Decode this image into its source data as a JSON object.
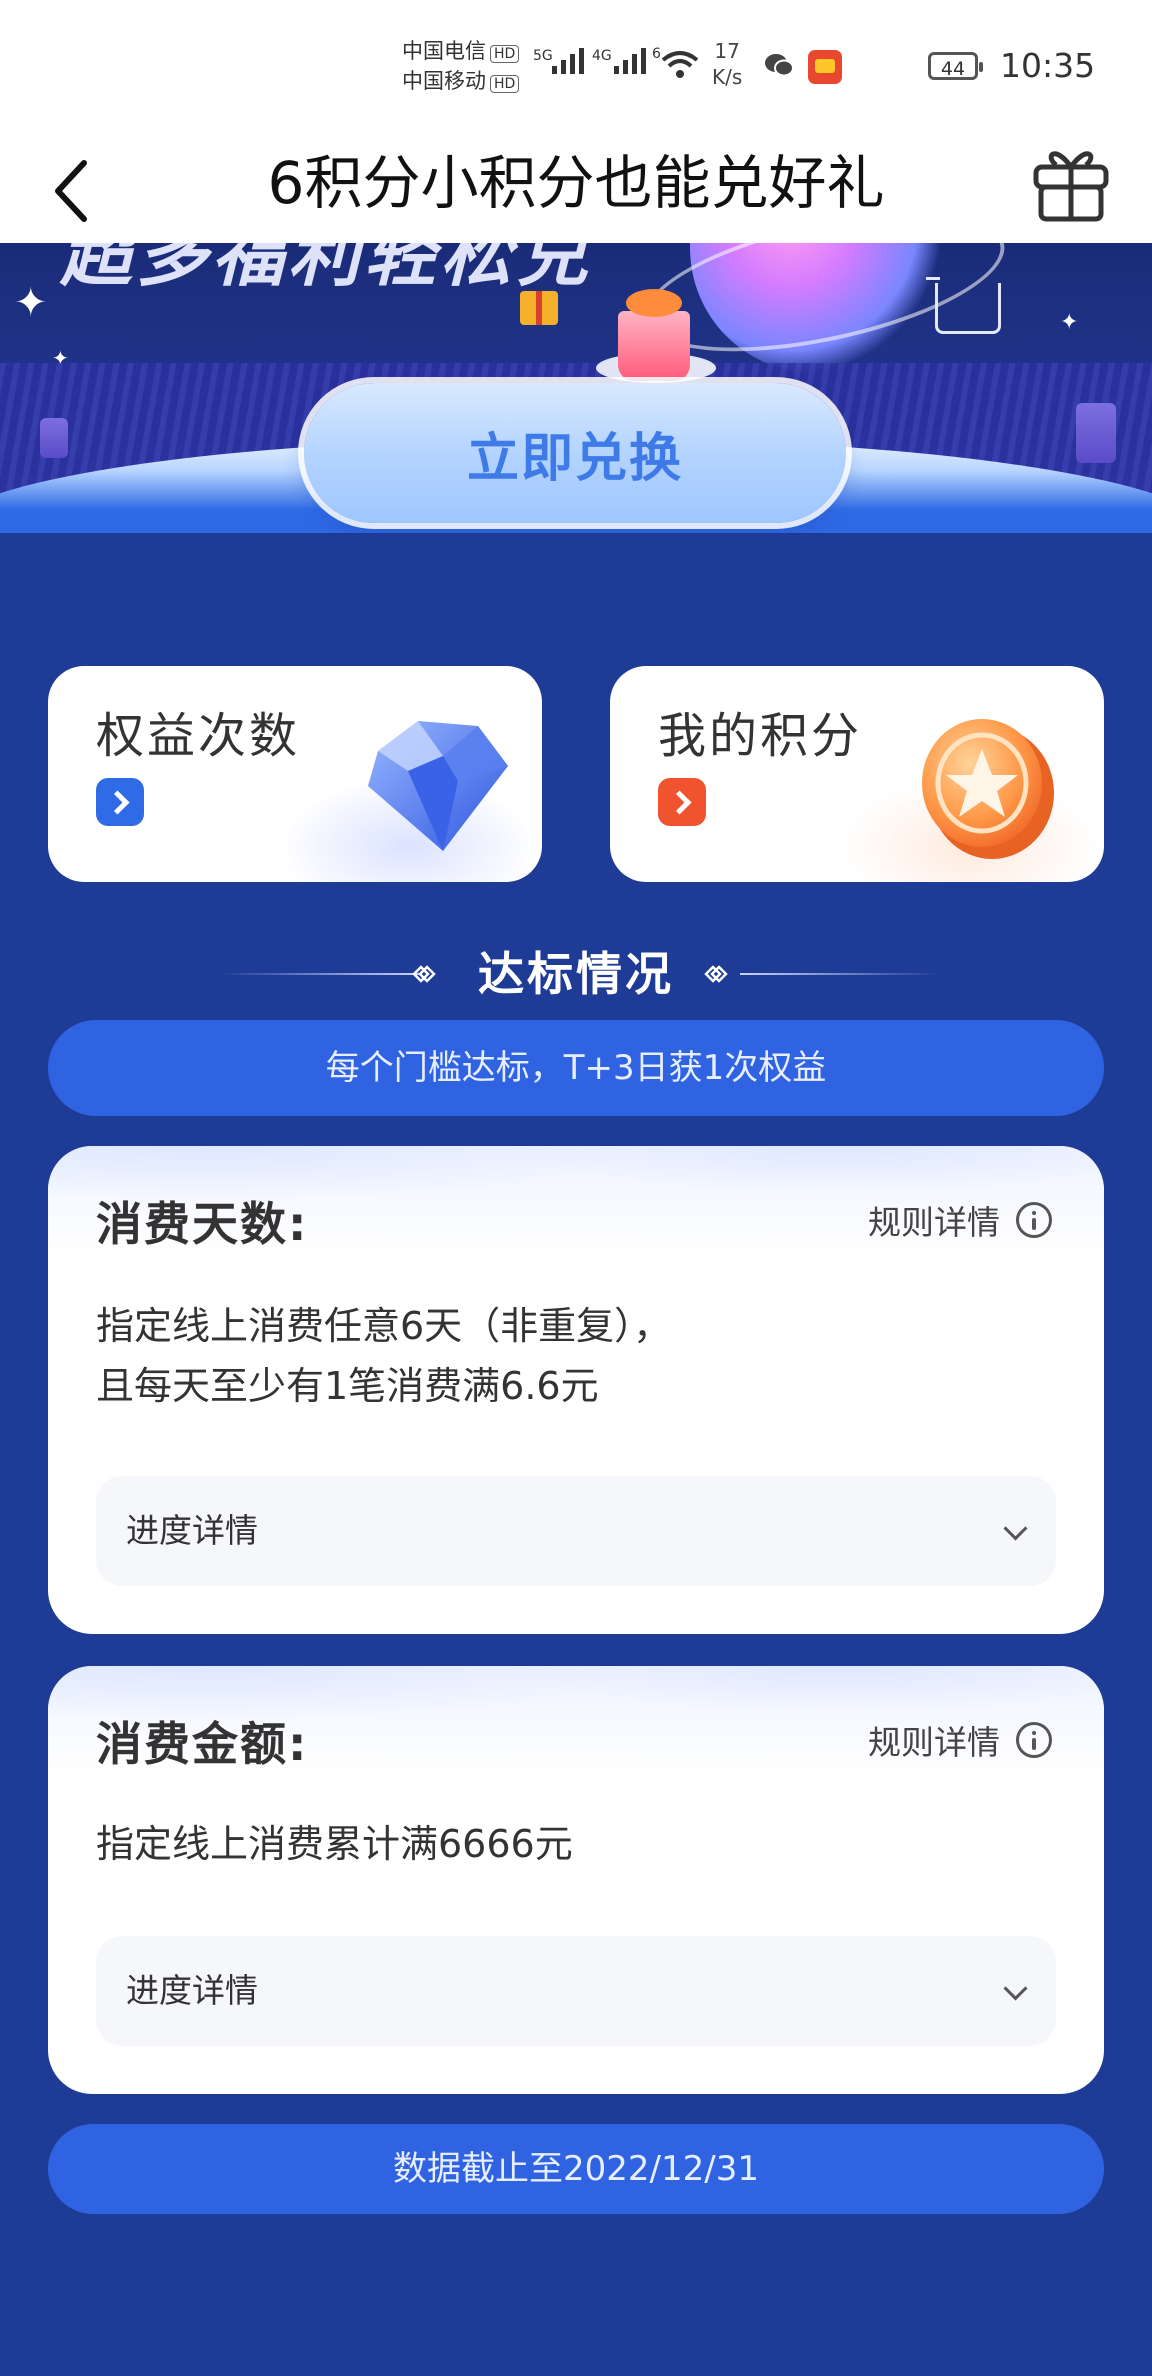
{
  "status_bar": {
    "carrier1": "中国电信",
    "carrier2": "中国移动",
    "hd_badge": "HD",
    "net_5g": "5G",
    "net_4g": "4G",
    "wifi_tag": "6",
    "speed_value": "17",
    "speed_unit": "K/s",
    "battery": "44",
    "time": "10:35",
    "icons": [
      "wechat-icon",
      "app-icon",
      "battery-icon"
    ]
  },
  "nav": {
    "title": "6积分小积分也能兑好礼",
    "back_icon": "back-arrow-icon",
    "gift_icon": "gift-icon"
  },
  "banner": {
    "headline": "超多福利轻松兑",
    "button": "立即兑换"
  },
  "entries": [
    {
      "label": "权益次数",
      "icon": "diamond-icon",
      "accent": "#2f6be6"
    },
    {
      "label": "我的积分",
      "icon": "coin-icon",
      "accent": "#f0542e"
    }
  ],
  "section": {
    "title": "达标情况",
    "notice": "每个门槛达标，T+3日获1次权益"
  },
  "rules": [
    {
      "title": "消费天数:",
      "link": "规则详情",
      "desc_line1": "指定线上消费任意6天（非重复），",
      "desc_line2": "且每天至少有1笔消费满6.6元",
      "progress_label": "进度详情"
    },
    {
      "title": "消费金额:",
      "link": "规则详情",
      "desc_line1": "指定线上消费累计满6666元",
      "progress_label": "进度详情"
    }
  ],
  "footer": {
    "note": "数据截止至2022/12/31"
  },
  "colors": {
    "page_bg": "#1e3c96",
    "pill_bg": "#2f63e2",
    "card_bg": "#ffffff"
  }
}
